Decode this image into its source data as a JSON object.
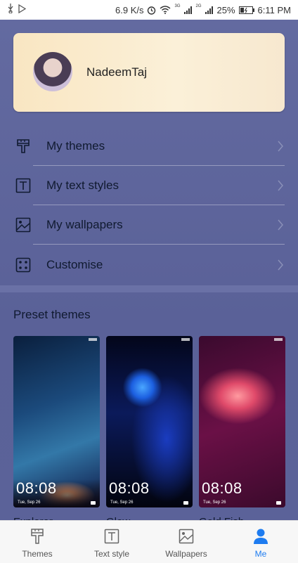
{
  "status_bar": {
    "network_speed": "6.9 K/s",
    "signal_1": "3G",
    "signal_2": "2G",
    "battery": "25%",
    "time": "6:11 PM"
  },
  "profile": {
    "username": "NadeemTaj"
  },
  "menu": [
    {
      "label": "My themes",
      "icon": "brush-icon"
    },
    {
      "label": "My text styles",
      "icon": "text-style-icon"
    },
    {
      "label": "My wallpapers",
      "icon": "wallpaper-icon"
    },
    {
      "label": "Customise",
      "icon": "customise-icon"
    }
  ],
  "preset": {
    "title": "Preset themes",
    "themes": [
      {
        "name": "Explorer",
        "time": "08:08",
        "date": "Tue, Sep 26"
      },
      {
        "name": "Glow",
        "time": "08:08",
        "date": "Tue, Sep 26"
      },
      {
        "name": "Gold Fish",
        "time": "08:08",
        "date": "Tue, Sep 26"
      }
    ]
  },
  "tabs": [
    {
      "label": "Themes",
      "icon": "brush-icon"
    },
    {
      "label": "Text style",
      "icon": "text-style-icon"
    },
    {
      "label": "Wallpapers",
      "icon": "wallpaper-icon"
    },
    {
      "label": "Me",
      "icon": "person-icon",
      "active": true
    }
  ],
  "colors": {
    "background": "#5e6599",
    "accent": "#1e7cf0"
  }
}
